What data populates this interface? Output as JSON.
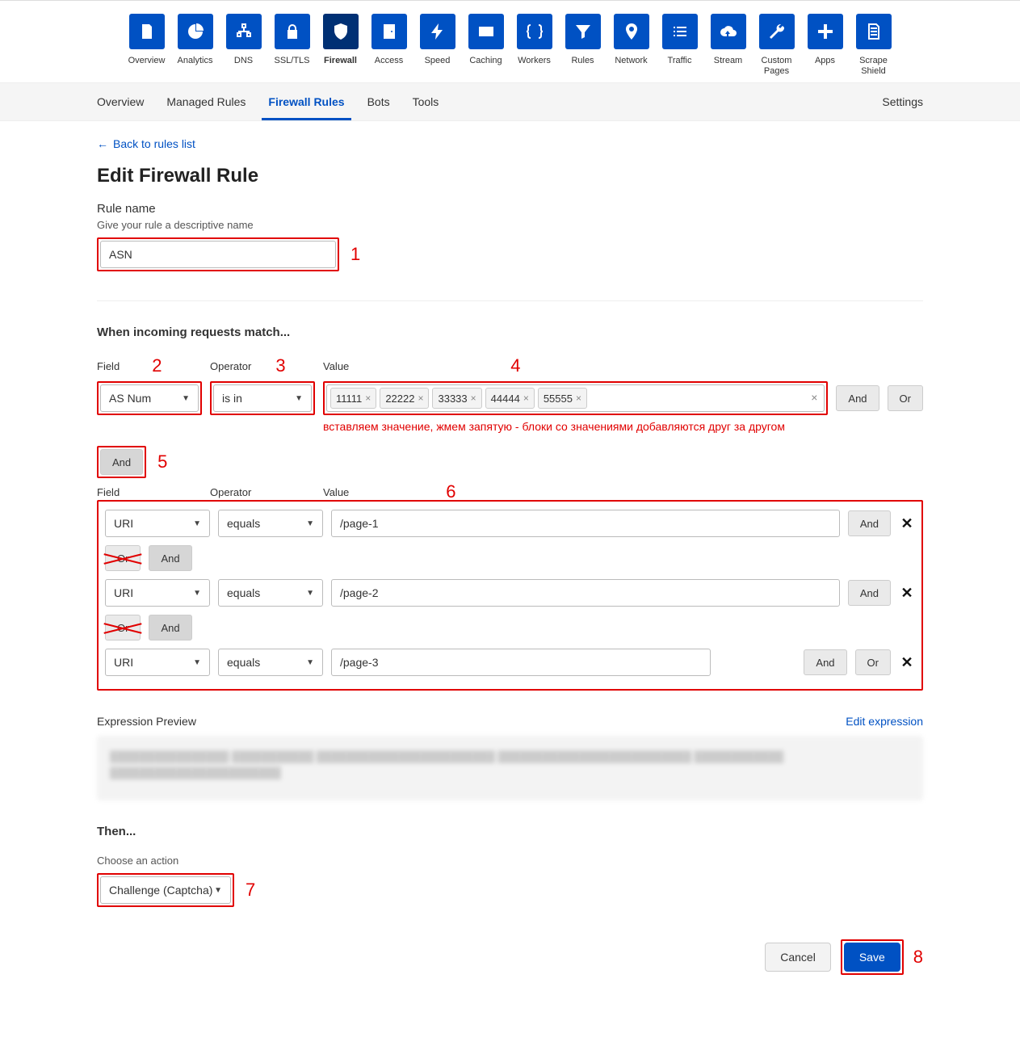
{
  "topnav": [
    {
      "icon": "doc",
      "label": "Overview"
    },
    {
      "icon": "pie",
      "label": "Analytics"
    },
    {
      "icon": "tree",
      "label": "DNS"
    },
    {
      "icon": "lock",
      "label": "SSL/TLS"
    },
    {
      "icon": "shield",
      "label": "Firewall",
      "active": true
    },
    {
      "icon": "door",
      "label": "Access"
    },
    {
      "icon": "bolt",
      "label": "Speed"
    },
    {
      "icon": "card",
      "label": "Caching"
    },
    {
      "icon": "braces",
      "label": "Workers"
    },
    {
      "icon": "funnel",
      "label": "Rules"
    },
    {
      "icon": "pin",
      "label": "Network"
    },
    {
      "icon": "list",
      "label": "Traffic"
    },
    {
      "icon": "cloud",
      "label": "Stream"
    },
    {
      "icon": "wrench",
      "label": "Custom Pages"
    },
    {
      "icon": "plus",
      "label": "Apps"
    },
    {
      "icon": "sheet",
      "label": "Scrape Shield"
    }
  ],
  "tabs": {
    "items": [
      "Overview",
      "Managed Rules",
      "Firewall Rules",
      "Bots",
      "Tools"
    ],
    "active": "Firewall Rules",
    "settings": "Settings"
  },
  "back_link": "Back to rules list",
  "page_title": "Edit Firewall Rule",
  "rule_name": {
    "label": "Rule name",
    "help": "Give your rule a descriptive name",
    "value": "ASN"
  },
  "match_title": "When incoming requests match...",
  "headers": {
    "field": "Field",
    "operator": "Operator",
    "value": "Value"
  },
  "row1": {
    "field": "AS Num",
    "operator": "is in",
    "values": [
      "11111",
      "22222",
      "33333",
      "44444",
      "55555"
    ],
    "and": "And",
    "or": "Or"
  },
  "value_note": "вставляем значение, жмем запятую - блоки со значениями добавляются друг за другом",
  "group_connector": {
    "and": "And"
  },
  "group_rows": [
    {
      "field": "URI",
      "operator": "equals",
      "value": "/page-1",
      "and": "And"
    },
    {
      "field": "URI",
      "operator": "equals",
      "value": "/page-2",
      "and": "And"
    },
    {
      "field": "URI",
      "operator": "equals",
      "value": "/page-3",
      "and": "And",
      "or": "Or"
    }
  ],
  "inner_logic": {
    "or": "Or",
    "and": "And"
  },
  "preview": {
    "label": "Expression Preview",
    "edit": "Edit expression"
  },
  "then": {
    "title": "Then...",
    "help": "Choose an action",
    "action": "Challenge (Captcha)"
  },
  "buttons": {
    "cancel": "Cancel",
    "save": "Save"
  },
  "anno": {
    "a1": "1",
    "a2": "2",
    "a3": "3",
    "a4": "4",
    "a5": "5",
    "a6": "6",
    "a7": "7",
    "a8": "8"
  }
}
